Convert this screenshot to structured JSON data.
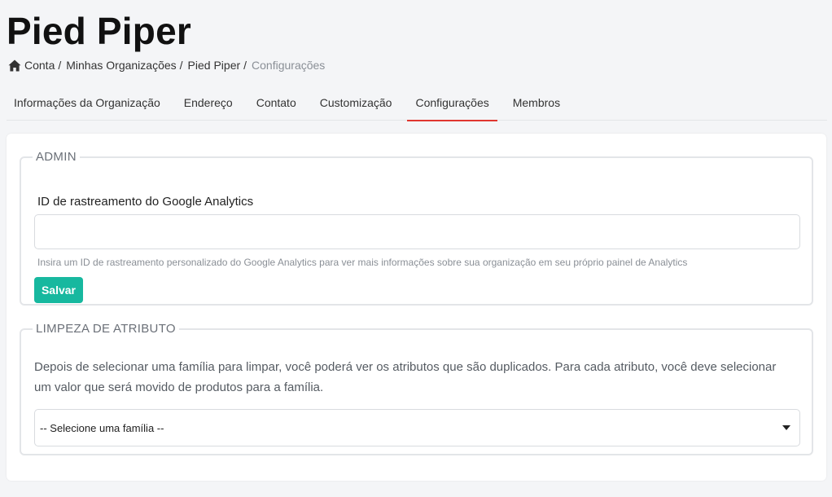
{
  "page": {
    "title": "Pied Piper"
  },
  "breadcrumb": {
    "items": [
      {
        "label": "Conta"
      },
      {
        "label": "Minhas Organizações"
      },
      {
        "label": "Pied Piper"
      },
      {
        "label": "Configurações"
      }
    ],
    "separator": "/"
  },
  "tabs": [
    {
      "label": "Informações da Organização"
    },
    {
      "label": "Endereço"
    },
    {
      "label": "Contato"
    },
    {
      "label": "Customização"
    },
    {
      "label": "Configurações",
      "active": true
    },
    {
      "label": "Membros"
    }
  ],
  "admin": {
    "legend": "ADMIN",
    "ga_label": "ID de rastreamento do Google Analytics",
    "ga_value": "",
    "ga_help": "Insira um ID de rastreamento personalizado do Google Analytics para ver mais informações sobre sua organização em seu próprio painel de Analytics",
    "save_label": "Salvar"
  },
  "cleanup": {
    "legend": "LIMPEZA DE ATRIBUTO",
    "description": "Depois de selecionar uma família para limpar, você poderá ver os atributos que são duplicados. Para cada atributo, você deve selecionar um valor que será movido de produtos para a família.",
    "select_value": "-- Selecione uma família --"
  },
  "colors": {
    "accent_tab": "#e0362f",
    "save_button": "#17b89f"
  },
  "icons": {
    "home": "home-icon",
    "caret": "caret-down-icon"
  }
}
